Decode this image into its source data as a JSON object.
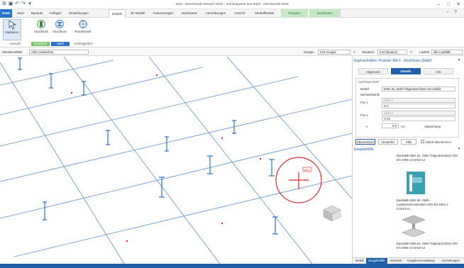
{
  "window": {
    "title": "Start - Zuschlussbl Beispiel 2025 - Stahltragwerk aus Stahl - Zuschlussbl 2025",
    "controls": [
      "–",
      "□",
      "✕"
    ]
  },
  "quick_access": [
    "↶",
    "↷",
    "▾"
  ],
  "tabs": [
    "Datei",
    "Start",
    "Bauteile",
    "Auflager",
    "Einwirkungen",
    "Details",
    "3D Modell",
    "Auswertungen",
    "Nachweise",
    "Anmerkungen",
    "Ansicht",
    "Modellfenster",
    "Eingabe",
    "Bearbeiten"
  ],
  "ribbon": {
    "buttons": [
      "Markieren",
      "Anschluss",
      "Anschluss",
      "Rundschnitt"
    ],
    "groups": [
      "Auswahl",
      "Stirnblech",
      "Stahl",
      "Schnittgrößen"
    ]
  },
  "filter": {
    "label": "Selektionsfilter",
    "value": "Alles markierbar",
    "group_label": "Gruppe",
    "group_value": "Inst Gruppe",
    "situation_label": "Situation",
    "situation_value": "Inst Situation",
    "lastfall_label": "Lastfall",
    "lastfall_value": "alle Lastfälle"
  },
  "properties": {
    "title": "Eigenschaften: Position 'AN-1 - Anschluss (Stahl)'",
    "tabs": [
      "Allgemein",
      "Details",
      "Info"
    ],
    "section": "Anschluss Stahl",
    "modell_label": "Modell",
    "modell_value": "5381 de, Stahl-Trägeranschluss mit Auslkl4",
    "nachweisstufe": "Nachweisstufe",
    "pos1_label": "Pos 1",
    "pos1_sub": "Stahl 1",
    "pos1_value": "S-4",
    "pos2_label": "Pos 2",
    "pos2_sub": "Stahl 2",
    "pos2_value": "S-16",
    "e_label": "e",
    "e_value": "0.5",
    "e_unit": "cm",
    "abweichung": "Abweichung",
    "buttons": [
      "Übernehmen",
      "Verwerfen",
      "Hilfe"
    ],
    "checkbox": "Sofort übernehmen"
  },
  "eingabehilfe": {
    "title": "Eingabehilfe",
    "items": [
      "Baustatik 5381.de, Stahl-Trägeranschluss DIN EN 1993-1-8:2010-12",
      "Baustatik 5392.de, Stahl-Laststeifenkonstruktion DIN EN 1993-1-8:2010-12",
      "Baustatik 5396.de, Stahl-Trägeranschluss DIN EN 1993-1-8:2010-12"
    ]
  },
  "bottom_tabs": [
    "Modell",
    "Eingabehilfe",
    "Hinweise",
    "Ausgabenverwaltung",
    "Anmerkungen"
  ],
  "canvas": {
    "marker": "AN-1"
  },
  "colors": {
    "accent": "#2b73c6",
    "grid": "#5a8fd0",
    "selection": "#d42a2a"
  }
}
